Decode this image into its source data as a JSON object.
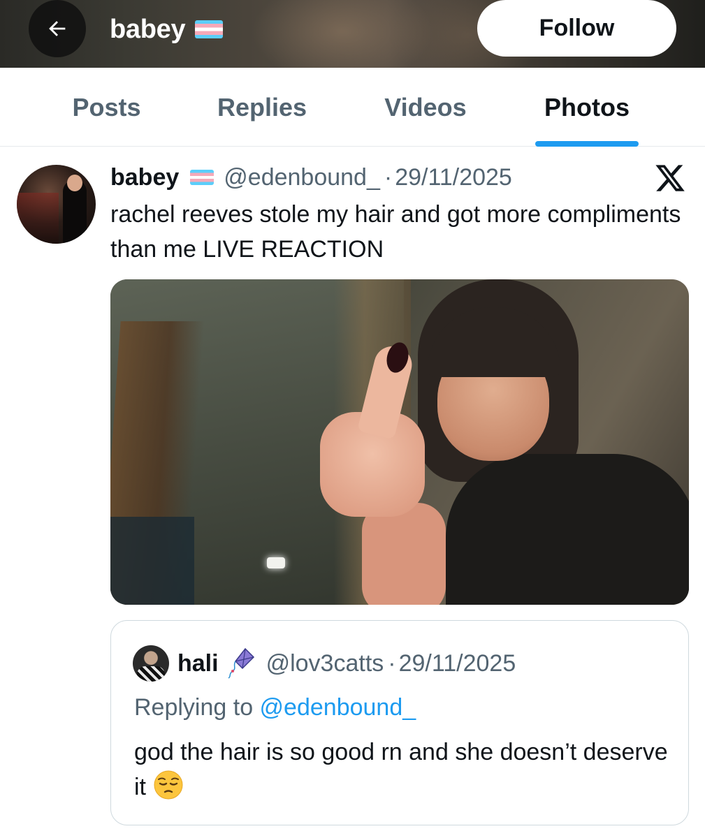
{
  "header": {
    "title": "babey",
    "title_flag": "transgender-flag",
    "follow_label": "Follow",
    "back_icon": "arrow-left-icon"
  },
  "tabs": [
    {
      "label": "Posts",
      "active": false
    },
    {
      "label": "Replies",
      "active": false
    },
    {
      "label": "Videos",
      "active": false
    },
    {
      "label": "Photos",
      "active": true
    }
  ],
  "post": {
    "author_name": "babey",
    "author_flag": "transgender-flag",
    "handle": "@edenbound_",
    "separator": "·",
    "date": "29/11/2025",
    "source_icon": "x-logo-icon",
    "text": "rachel reeves stole my hair and got more compliments than me LIVE REACTION",
    "media": "selfie-photo"
  },
  "quote": {
    "author_name": "hali",
    "author_emoji": "kite-emoji",
    "handle": "@lov3catts",
    "separator": "·",
    "date": "29/11/2025",
    "replying_prefix": "Replying to ",
    "replying_to": "@edenbound_",
    "text": "god the hair is so good rn and she doesn’t deserve it",
    "text_emoji": "pensive-face-emoji"
  },
  "colors": {
    "accent": "#1d9bf0",
    "text_primary": "#0f1419",
    "text_secondary": "#536471",
    "border": "#cfd9de"
  }
}
